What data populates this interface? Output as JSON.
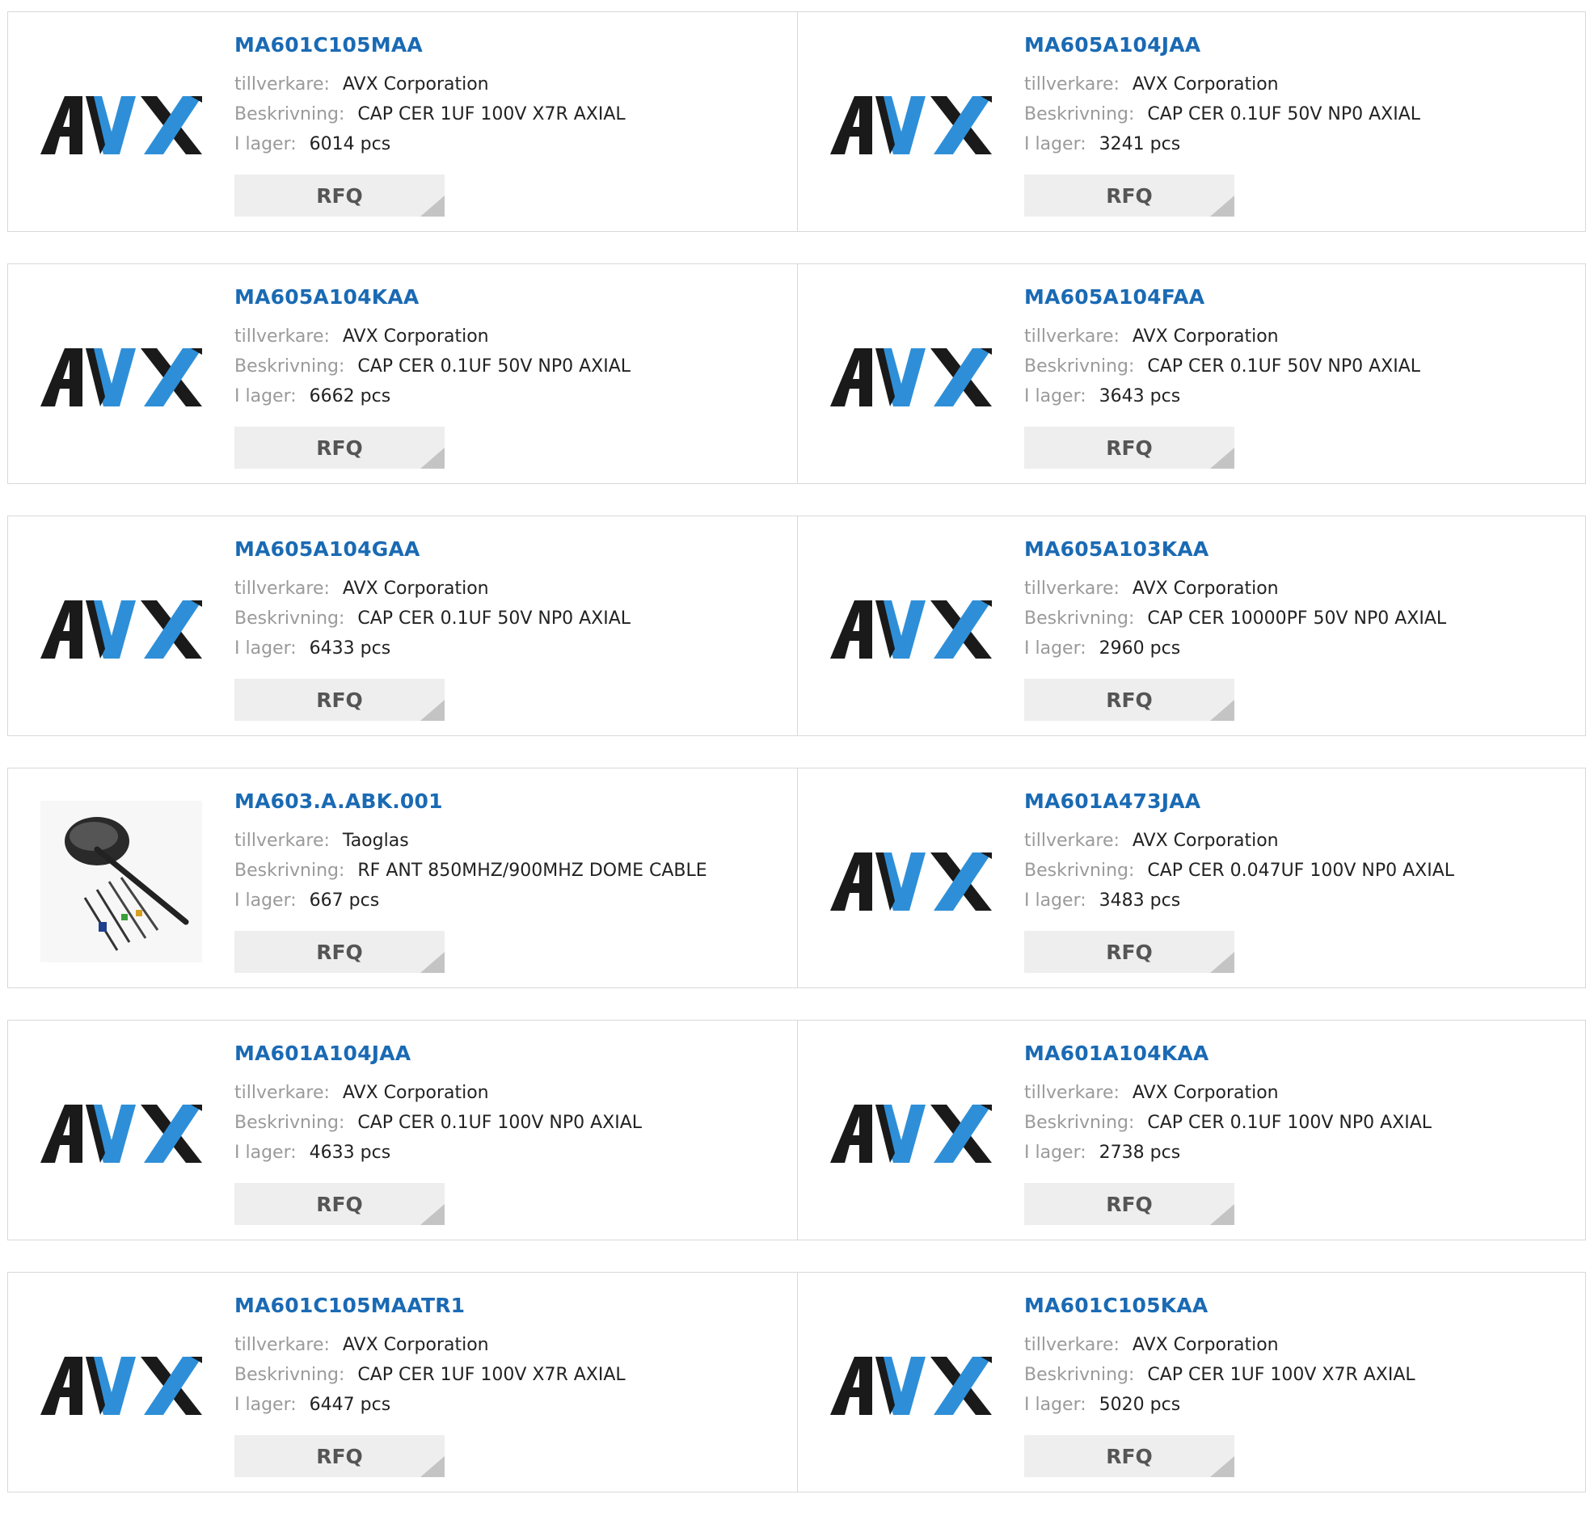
{
  "labels": {
    "manufacturer": "tillverkare:",
    "description": "Beskrivning:",
    "stock": "I lager:",
    "rfq": "RFQ"
  },
  "colors": {
    "link": "#1a6ab4",
    "avx_black": "#1a1a1a",
    "avx_blue": "#2e8fd8"
  },
  "rows": [
    [
      {
        "part": "MA601C105MAA",
        "manufacturer": "AVX Corporation",
        "description": "CAP CER 1UF 100V X7R AXIAL",
        "stock": "6014 pcs",
        "logo": "avx-logo"
      },
      {
        "part": "MA605A104JAA",
        "manufacturer": "AVX Corporation",
        "description": "CAP CER 0.1UF 50V NP0 AXIAL",
        "stock": "3241 pcs",
        "logo": "avx-logo"
      }
    ],
    [
      {
        "part": "MA605A104KAA",
        "manufacturer": "AVX Corporation",
        "description": "CAP CER 0.1UF 50V NP0 AXIAL",
        "stock": "6662 pcs",
        "logo": "avx-logo"
      },
      {
        "part": "MA605A104FAA",
        "manufacturer": "AVX Corporation",
        "description": "CAP CER 0.1UF 50V NP0 AXIAL",
        "stock": "3643 pcs",
        "logo": "avx-logo"
      }
    ],
    [
      {
        "part": "MA605A104GAA",
        "manufacturer": "AVX Corporation",
        "description": "CAP CER 0.1UF 50V NP0 AXIAL",
        "stock": "6433 pcs",
        "logo": "avx-logo"
      },
      {
        "part": "MA605A103KAA",
        "manufacturer": "AVX Corporation",
        "description": "CAP CER 10000PF 50V NP0 AXIAL",
        "stock": "2960 pcs",
        "logo": "avx-logo"
      }
    ],
    [
      {
        "part": "MA603.A.ABK.001",
        "manufacturer": "Taoglas",
        "description": "RF ANT 850MHZ/900MHZ DOME CABLE",
        "stock": "667 pcs",
        "logo": "antenna-product-image"
      },
      {
        "part": "MA601A473JAA",
        "manufacturer": "AVX Corporation",
        "description": "CAP CER 0.047UF 100V NP0 AXIAL",
        "stock": "3483 pcs",
        "logo": "avx-logo"
      }
    ],
    [
      {
        "part": "MA601A104JAA",
        "manufacturer": "AVX Corporation",
        "description": "CAP CER 0.1UF 100V NP0 AXIAL",
        "stock": "4633 pcs",
        "logo": "avx-logo"
      },
      {
        "part": "MA601A104KAA",
        "manufacturer": "AVX Corporation",
        "description": "CAP CER 0.1UF 100V NP0 AXIAL",
        "stock": "2738 pcs",
        "logo": "avx-logo"
      }
    ],
    [
      {
        "part": "MA601C105MAATR1",
        "manufacturer": "AVX Corporation",
        "description": "CAP CER 1UF 100V X7R AXIAL",
        "stock": "6447 pcs",
        "logo": "avx-logo"
      },
      {
        "part": "MA601C105KAA",
        "manufacturer": "AVX Corporation",
        "description": "CAP CER 1UF 100V X7R AXIAL",
        "stock": "5020 pcs",
        "logo": "avx-logo"
      }
    ]
  ]
}
